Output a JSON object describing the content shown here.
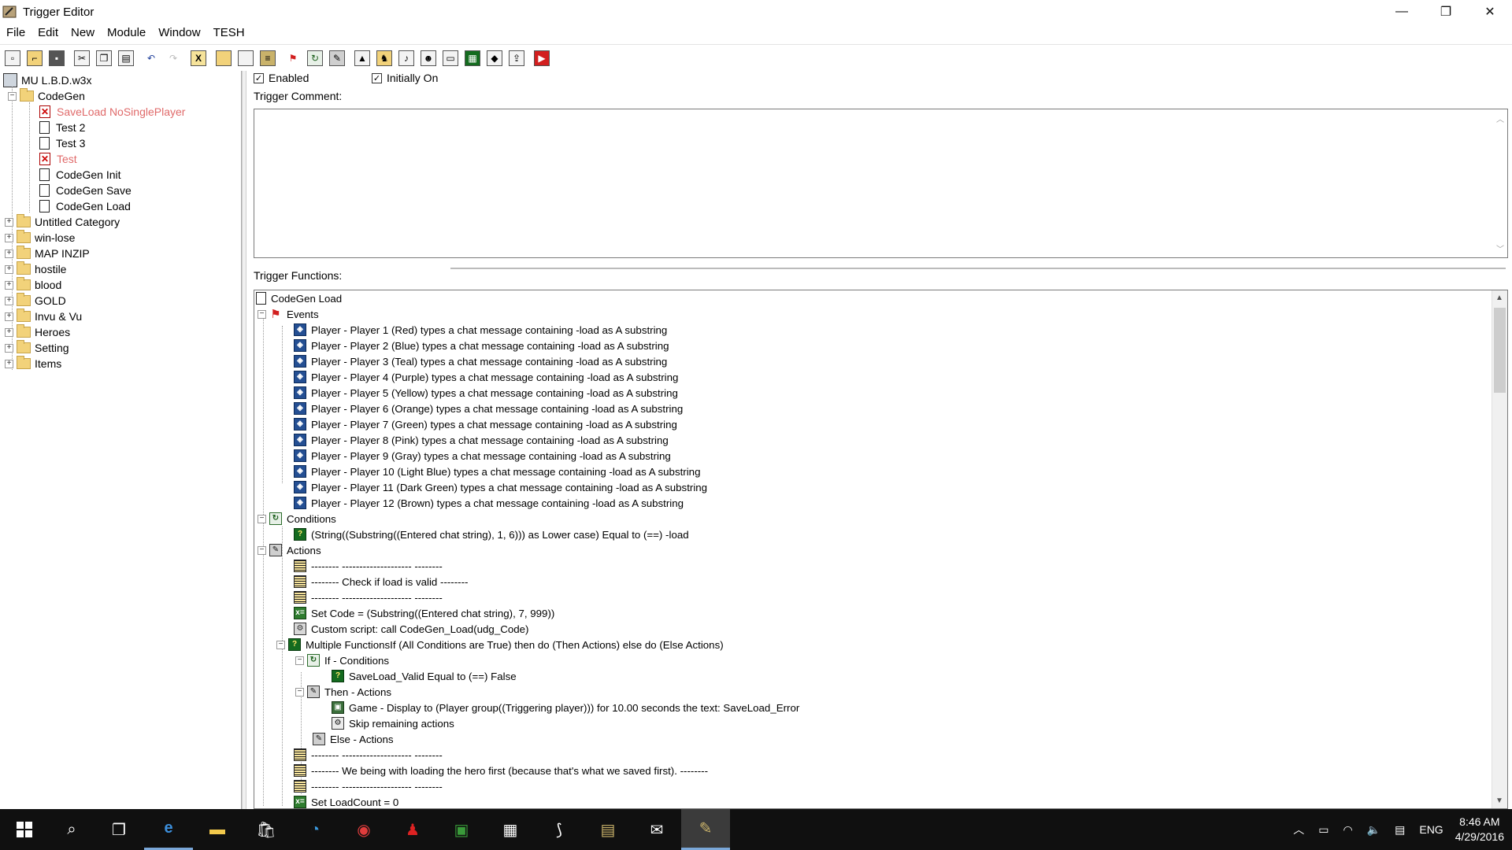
{
  "window": {
    "title": "Trigger Editor",
    "controls": [
      "—",
      "❐",
      "✕"
    ]
  },
  "menu": [
    "File",
    "Edit",
    "New",
    "Module",
    "Window",
    "TESH"
  ],
  "toolbar_icons": [
    "new-icon",
    "open-icon",
    "save-icon",
    "cut-icon",
    "copy-icon",
    "paste-icon",
    "undo-icon",
    "redo-icon",
    "delete-icon",
    "new-category-icon",
    "new-trigger-icon",
    "new-comment-icon",
    "new-event-icon",
    "new-condition-icon",
    "new-action-icon",
    "terrain-editor-icon",
    "unit-editor-icon",
    "sound-editor-icon",
    "object-editor-icon",
    "campaign-editor-icon",
    "ai-editor-icon",
    "object-manager-icon",
    "import-manager-icon",
    "test-map-icon"
  ],
  "tree": {
    "root": "MU L.B.D.w3x",
    "codegen_folder": "CodeGen",
    "codegen_children": [
      {
        "label": "SaveLoad NoSinglePlayer",
        "disabled": true
      },
      {
        "label": "Test 2",
        "disabled": false
      },
      {
        "label": "Test 3",
        "disabled": false
      },
      {
        "label": "Test",
        "disabled": true
      },
      {
        "label": "CodeGen Init",
        "disabled": false
      },
      {
        "label": "CodeGen Save",
        "disabled": false
      },
      {
        "label": "CodeGen Load",
        "disabled": false
      }
    ],
    "categories": [
      "Untitled Category",
      "win-lose",
      "MAP INZIP",
      "hostile",
      "blood",
      "GOLD",
      "Invu & Vu",
      "Heroes",
      "Setting",
      "Items"
    ]
  },
  "trigger": {
    "enabled_label": "Enabled",
    "initially_on_label": "Initially On",
    "comment_label": "Trigger Comment:",
    "functions_label": "Trigger Functions:",
    "name": "CodeGen Load",
    "events_label": "Events",
    "events": [
      "Player - Player 1 (Red) types a chat message containing -load  as A substring",
      "Player - Player 2 (Blue) types a chat message containing -load  as A substring",
      "Player - Player 3 (Teal) types a chat message containing -load  as A substring",
      "Player - Player 4 (Purple) types a chat message containing -load  as A substring",
      "Player - Player 5 (Yellow) types a chat message containing -load  as A substring",
      "Player - Player 6 (Orange) types a chat message containing -load  as A substring",
      "Player - Player 7 (Green) types a chat message containing -load  as A substring",
      "Player - Player 8 (Pink) types a chat message containing -load  as A substring",
      "Player - Player 9 (Gray) types a chat message containing -load  as A substring",
      "Player - Player 10 (Light Blue) types a chat message containing -load  as A substring",
      "Player - Player 11 (Dark Green) types a chat message containing -load  as A substring",
      "Player - Player 12 (Brown) types a chat message containing -load  as A substring"
    ],
    "conditions_label": "Conditions",
    "condition": "(String((Substring((Entered chat string), 1, 6))) as Lower case) Equal to (==) -load",
    "actions_label": "Actions",
    "actions": {
      "c1": "-------- -------------------- --------",
      "c2": "-------- Check if load is valid --------",
      "c3": "-------- -------------------- --------",
      "set_code": "Set Code = (Substring((Entered chat string), 7, 999))",
      "custom": "Custom script:   call CodeGen_Load(udg_Code)",
      "multi": "Multiple FunctionsIf (All Conditions are True) then do (Then Actions) else do (Else Actions)",
      "if_label": "If - Conditions",
      "if_cond": "SaveLoad_Valid Equal to (==) False",
      "then_label": "Then - Actions",
      "then_1": "Game - Display to (Player group((Triggering player))) for 10.00 seconds the text: SaveLoad_Error",
      "then_2": "Skip remaining actions",
      "else_label": "Else - Actions",
      "c4": "-------- -------------------- --------",
      "c5": "-------- We being with loading the hero first (because that's what we saved first). --------",
      "c6": "-------- -------------------- --------",
      "set_loadcount": "Set LoadCount = 0"
    }
  },
  "taskbar": {
    "apps": [
      "start-icon",
      "search-icon",
      "task-view-icon",
      "edge-icon",
      "file-explorer-icon",
      "store-icon",
      "cortana-app-icon",
      "antivirus-icon",
      "game-icon",
      "worldedit-icon",
      "media-icon",
      "steam-icon",
      "scroll-icon",
      "mail-icon",
      "trigger-editor-icon"
    ],
    "tray_lang": "ENG",
    "time": "8:46 AM",
    "date": "4/29/2016"
  }
}
